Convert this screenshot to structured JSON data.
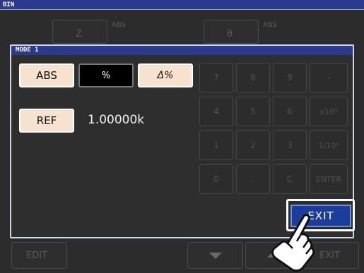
{
  "window": {
    "title": "BIN"
  },
  "background": {
    "param1": {
      "label": "Z",
      "mode": "ABS"
    },
    "param2": {
      "label": "θ",
      "mode": "ABS"
    },
    "edit_label": "EDIT",
    "exit_label": "EXIT"
  },
  "dialog": {
    "title": "MODE 1",
    "mode_buttons": {
      "abs": "ABS",
      "percent": "%",
      "delta_percent": "Δ%"
    },
    "selected_mode": "%",
    "ref_label": "REF",
    "ref_value": "1.00000k",
    "keypad": [
      "7",
      "8",
      "9",
      "-",
      "4",
      "5",
      "6",
      "x10³",
      "1",
      "2",
      "3",
      "1/10³",
      "0",
      ".",
      "C",
      "ENTER"
    ],
    "exit_label": "EXIT"
  },
  "colors": {
    "title_bar": "#2a3a8c",
    "light_button": "#f6e2cf",
    "exit_button": "#1c3d9c"
  }
}
